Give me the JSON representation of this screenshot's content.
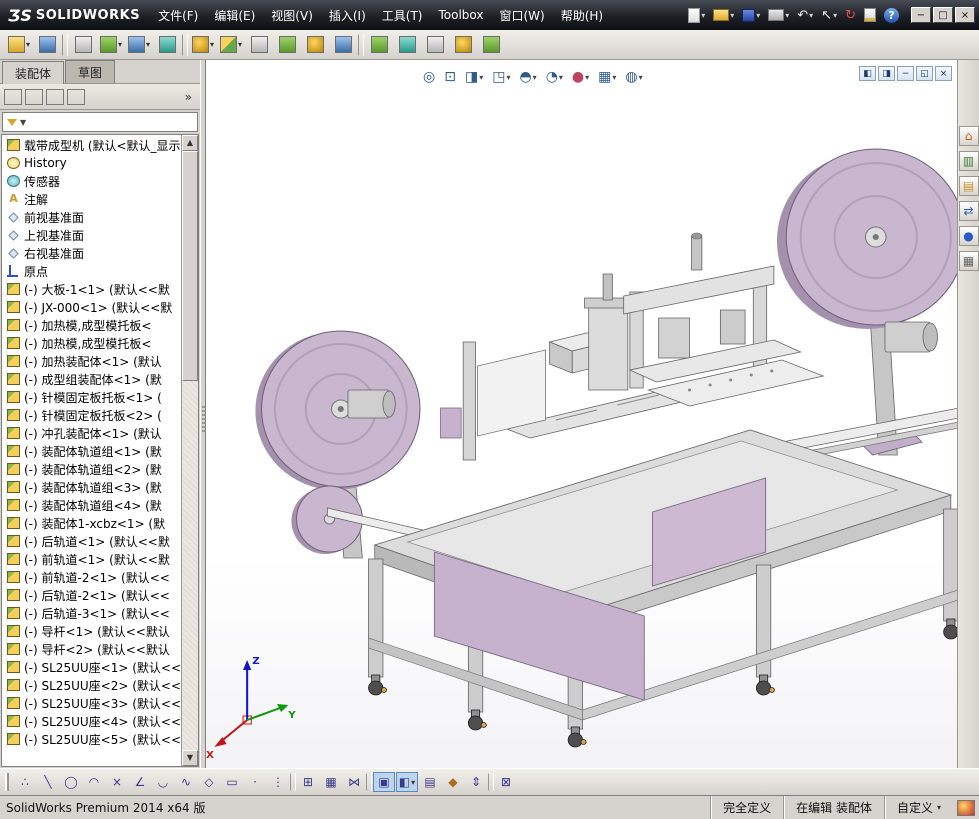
{
  "window": {
    "logo_mark": "ƷS",
    "logo_text": "SOLIDWORKS",
    "controls": [
      {
        "name": "minimize-button",
        "g": "−"
      },
      {
        "name": "maximize-button",
        "g": "□"
      },
      {
        "name": "close-button",
        "g": "×"
      }
    ]
  },
  "menu": {
    "items": [
      {
        "name": "menu-file",
        "label": "文件(F)"
      },
      {
        "name": "menu-edit",
        "label": "编辑(E)"
      },
      {
        "name": "menu-view",
        "label": "视图(V)"
      },
      {
        "name": "menu-insert",
        "label": "插入(I)"
      },
      {
        "name": "menu-tools",
        "label": "工具(T)"
      },
      {
        "name": "menu-toolbox",
        "label": "Toolbox"
      },
      {
        "name": "menu-window",
        "label": "窗口(W)"
      },
      {
        "name": "menu-help",
        "label": "帮助(H)"
      }
    ]
  },
  "std_icons": [
    {
      "name": "new-document-button",
      "cls": "g-page",
      "g": "",
      "dd": true
    },
    {
      "name": "open-button",
      "cls": "g-folder",
      "g": "",
      "dd": true
    },
    {
      "name": "save-button",
      "cls": "g-disk",
      "g": "",
      "dd": true
    },
    {
      "name": "print-button",
      "cls": "g-print",
      "g": "",
      "dd": true
    },
    {
      "name": "undo-button",
      "cls": "g-glyph",
      "g": "↶",
      "dd": true
    },
    {
      "name": "select-button",
      "cls": "g-glyph",
      "g": "↖",
      "dd": true
    },
    {
      "name": "rebuild-button",
      "cls": "g-rebuild",
      "g": "↻"
    },
    {
      "name": "file-properties-button",
      "cls": "g-edit",
      "g": ""
    },
    {
      "name": "help-button",
      "cls": "g-help",
      "g": "?"
    }
  ],
  "toolbar": {
    "icons": [
      {
        "name": "insert-components-button",
        "cls2": "c-yellow",
        "dd": true
      },
      {
        "name": "mate-button",
        "cls2": "c-blue"
      },
      {
        "cls": "sep"
      },
      {
        "name": "smart-fasteners-button",
        "cls2": "c-gray"
      },
      {
        "name": "linear-component-pattern-button",
        "cls2": "c-green",
        "dd": true
      },
      {
        "name": "move-component-button",
        "cls2": "c-blue",
        "dd": true
      },
      {
        "name": "show-hidden-components-button",
        "cls2": "c-teal"
      },
      {
        "cls": "sep"
      },
      {
        "name": "assembly-features-button",
        "cls2": "c-gold",
        "dd": true
      },
      {
        "name": "reference-geometry-button",
        "cls2": "c-mix",
        "dd": true
      },
      {
        "name": "new-motion-study-button",
        "cls2": "c-gray"
      },
      {
        "name": "bill-of-materials-button",
        "cls2": "c-green"
      },
      {
        "name": "exploded-view-button",
        "cls2": "c-gold"
      },
      {
        "name": "explode-line-sketch-button",
        "cls2": "c-blue"
      },
      {
        "cls": "sep"
      },
      {
        "name": "interference-detection-button",
        "cls2": "c-green"
      },
      {
        "name": "clearance-verification-button",
        "cls2": "c-teal"
      },
      {
        "name": "hole-alignment-button",
        "cls2": "c-gray"
      },
      {
        "name": "measure-button",
        "cls2": "c-gold"
      },
      {
        "name": "performance-evaluation-button",
        "cls2": "c-green"
      }
    ]
  },
  "panel": {
    "tabs": [
      {
        "name": "tab-assembly",
        "label": "装配体",
        "cls": "active"
      },
      {
        "name": "tab-sketch",
        "label": "草图"
      }
    ],
    "fm_tabs": [
      {
        "name": "featuremanager-tree-tab",
        "cls": "fm1"
      },
      {
        "name": "propertymanager-tab",
        "cls": "fm2"
      },
      {
        "name": "configurationmanager-tab",
        "cls": "fm3"
      },
      {
        "name": "displaymanager-tab",
        "cls": "fm4"
      }
    ],
    "expand_glyph": "»"
  },
  "tree": {
    "items": [
      {
        "icon": "root",
        "g": "",
        "label": "载带成型机 (默认<默认_显示"
      },
      {
        "icon": "hist",
        "g": "",
        "label": "History"
      },
      {
        "icon": "sensor",
        "g": "",
        "label": "传感器"
      },
      {
        "icon": "ann",
        "g": "A",
        "label": "注解"
      },
      {
        "icon": "plane",
        "g": "",
        "label": "前视基准面"
      },
      {
        "icon": "plane",
        "g": "",
        "label": "上视基准面"
      },
      {
        "icon": "plane",
        "g": "",
        "label": "右视基准面"
      },
      {
        "icon": "origin",
        "g": "",
        "label": "原点"
      },
      {
        "icon": "asm",
        "g": "",
        "label": "(-) 大板-1<1> (默认<<默"
      },
      {
        "icon": "asm",
        "g": "",
        "label": "(-) JX-000<1> (默认<<默"
      },
      {
        "icon": "asm",
        "g": "",
        "label": "(-) 加热模,成型模托板<"
      },
      {
        "icon": "asm",
        "g": "",
        "label": "(-) 加热模,成型模托板<"
      },
      {
        "icon": "asm",
        "g": "",
        "label": "(-) 加热装配体<1> (默认"
      },
      {
        "icon": "asm",
        "g": "",
        "label": "(-) 成型组装配体<1> (默"
      },
      {
        "icon": "asm",
        "g": "",
        "label": "(-) 针模固定板托板<1> ("
      },
      {
        "icon": "asm",
        "g": "",
        "label": "(-) 针模固定板托板<2> ("
      },
      {
        "icon": "asm",
        "g": "",
        "label": "(-) 冲孔装配体<1> (默认"
      },
      {
        "icon": "asm",
        "g": "",
        "label": "(-) 装配体轨道组<1> (默"
      },
      {
        "icon": "asm",
        "g": "",
        "label": "(-) 装配体轨道组<2> (默"
      },
      {
        "icon": "asm",
        "g": "",
        "label": "(-) 装配体轨道组<3> (默"
      },
      {
        "icon": "asm",
        "g": "",
        "label": "(-) 装配体轨道组<4> (默"
      },
      {
        "icon": "asm",
        "g": "",
        "label": "(-) 装配体1-xcbz<1> (默"
      },
      {
        "icon": "asm",
        "g": "",
        "label": "(-) 后轨道<1> (默认<<默"
      },
      {
        "icon": "asm",
        "g": "",
        "label": "(-) 前轨道<1> (默认<<默"
      },
      {
        "icon": "asm",
        "g": "",
        "label": "(-) 前轨道-2<1> (默认<<"
      },
      {
        "icon": "asm",
        "g": "",
        "label": "(-) 后轨道-2<1> (默认<<"
      },
      {
        "icon": "asm",
        "g": "",
        "label": "(-) 后轨道-3<1> (默认<<"
      },
      {
        "icon": "asm",
        "g": "",
        "label": "(-) 导杆<1> (默认<<默认"
      },
      {
        "icon": "asm",
        "g": "",
        "label": "(-) 导杆<2> (默认<<默认"
      },
      {
        "icon": "asm",
        "g": "",
        "label": "(-) SL25UU座<1> (默认<<"
      },
      {
        "icon": "asm",
        "g": "",
        "label": "(-) SL25UU座<2> (默认<<"
      },
      {
        "icon": "asm",
        "g": "",
        "label": "(-) SL25UU座<3> (默认<<"
      },
      {
        "icon": "asm",
        "g": "",
        "label": "(-) SL25UU座<4> (默认<<"
      },
      {
        "icon": "asm",
        "g": "",
        "label": "(-) SL25UU座<5> (默认<<"
      }
    ]
  },
  "viewport": {
    "hud": [
      {
        "name": "zoom-fit-button",
        "g": "◎"
      },
      {
        "name": "zoom-area-button",
        "g": "⊡"
      },
      {
        "name": "section-view-button",
        "g": "◨",
        "dd": true
      },
      {
        "name": "view-orientation-button",
        "g": "◳",
        "dd": true
      },
      {
        "name": "display-style-button",
        "g": "◓",
        "dd": true
      },
      {
        "name": "hide-show-items-button",
        "g": "◔",
        "dd": true
      },
      {
        "name": "edit-appearance-button",
        "g": "●",
        "gc": "hud-ball",
        "dd": true
      },
      {
        "name": "apply-scene-button",
        "g": "▦",
        "dd": true
      },
      {
        "name": "view-settings-button",
        "g": "◍",
        "dd": true
      }
    ],
    "doc_controls": [
      {
        "name": "doc-pane-left-button",
        "g": "◧"
      },
      {
        "name": "doc-pane-right-button",
        "g": "◨"
      },
      {
        "name": "doc-minimize-button",
        "g": "−"
      },
      {
        "name": "doc-restore-button",
        "g": "◱"
      },
      {
        "name": "doc-close-button",
        "g": "×"
      }
    ],
    "triad": {
      "x": "X",
      "y": "Y",
      "z": "Z"
    }
  },
  "taskpane": {
    "icons": [
      {
        "name": "solidworks-resources-tab",
        "g": "⌂",
        "gc": "tp-home"
      },
      {
        "name": "design-library-tab",
        "g": "▥",
        "gc": "tp-lib"
      },
      {
        "name": "file-explorer-tab",
        "g": "▤",
        "gc": "tp-folder"
      },
      {
        "name": "view-palette-tab",
        "g": "⇄",
        "gc": "tp-view"
      },
      {
        "name": "appearances-scenes-tab",
        "g": "●",
        "gc": "tp-ball"
      },
      {
        "name": "custom-properties-tab",
        "g": "▦",
        "gc": "tp-props"
      }
    ]
  },
  "bottom_toolbar": {
    "icons": [
      {
        "name": "sketch-entities-button",
        "g": "∴"
      },
      {
        "name": "line-tool-button",
        "g": "╲"
      },
      {
        "name": "circle-tool-button",
        "g": "◯"
      },
      {
        "name": "arc-tool-button",
        "g": "◠"
      },
      {
        "name": "trim-entities-button",
        "g": "×"
      },
      {
        "name": "chamfer-tool-button",
        "g": "∠"
      },
      {
        "name": "tangent-arc-button",
        "g": "◡"
      },
      {
        "name": "spline-tool-button",
        "g": "∿"
      },
      {
        "name": "polygon-tool-button",
        "g": "◇"
      },
      {
        "name": "rectangle-tool-button",
        "g": "▭"
      },
      {
        "name": "point-tool-button",
        "g": "·"
      },
      {
        "name": "centerline-tool-button",
        "g": "⋮"
      },
      {
        "cls": "sep"
      },
      {
        "name": "quick-snaps-button",
        "g": "⊞"
      },
      {
        "name": "grid-settings-button",
        "g": "▦"
      },
      {
        "name": "convert-entities-button",
        "g": "⋈"
      },
      {
        "cls": "sep"
      },
      {
        "name": "normal-to-button",
        "g": "▣",
        "cls": "active"
      },
      {
        "name": "shaded-with-edges-button",
        "g": "◧",
        "cls": "active",
        "dd": true
      },
      {
        "name": "apply-scene-button",
        "g": "▤"
      },
      {
        "name": "material-button",
        "g": "◆",
        "gc": "bg-orange"
      },
      {
        "name": "measure-button",
        "g": "⇕"
      },
      {
        "cls": "sep"
      },
      {
        "name": "exit-sketch-button",
        "g": "⊠"
      }
    ]
  },
  "statusbar": {
    "left": "SolidWorks Premium 2014 x64 版",
    "cells": [
      {
        "name": "status-fully-defined",
        "label": "完全定义"
      },
      {
        "name": "status-editing",
        "label": "在编辑 装配体"
      },
      {
        "name": "status-custom",
        "label": "自定义",
        "dd": true
      }
    ]
  },
  "colors": {
    "titlebar": "#1b1e24",
    "chrome": "#d6d3ce",
    "accent": "#316ac5",
    "machine_mauve": "#c9b6cf",
    "viewport_bg": "#ffffff"
  }
}
